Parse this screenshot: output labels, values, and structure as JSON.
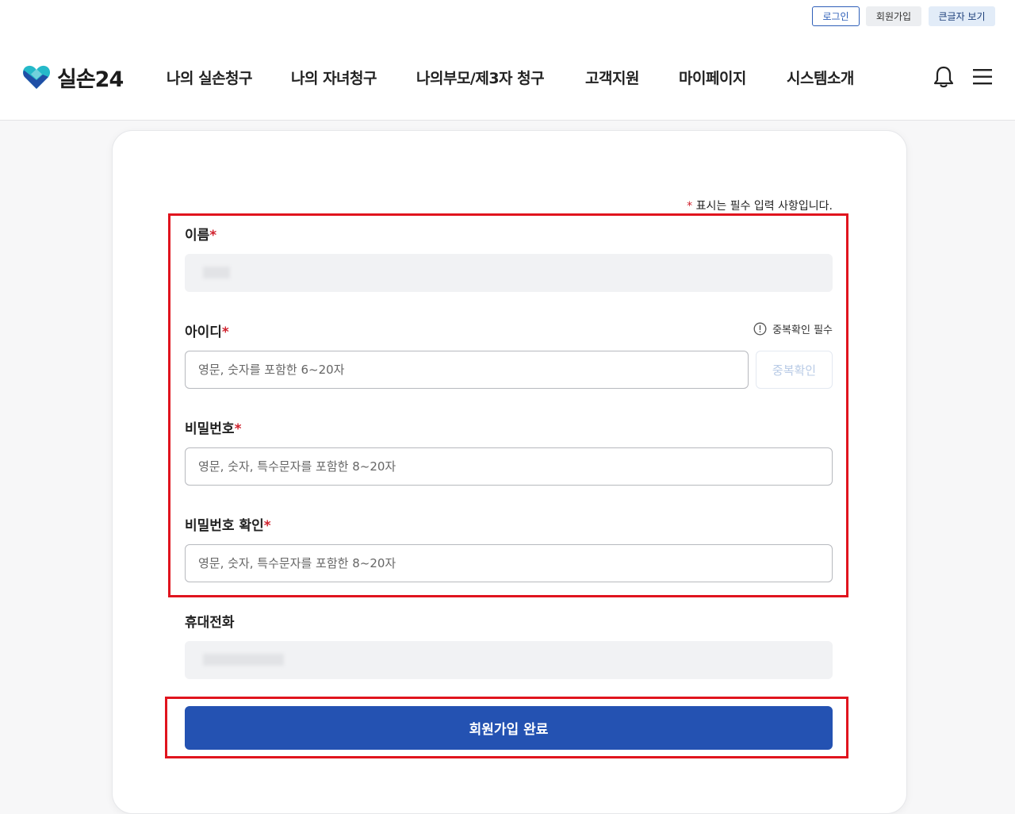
{
  "header": {
    "util": {
      "login": "로그인",
      "join": "회원가입",
      "large_text": "큰글자 보기"
    },
    "logo_text": "실손24",
    "nav": [
      "나의 실손청구",
      "나의 자녀청구",
      "나의부모/제3자 청구",
      "고객지원",
      "마이페이지",
      "시스템소개"
    ],
    "icons": [
      "bell-icon",
      "menu-icon"
    ]
  },
  "form": {
    "required_note": "표시는 필수 입력 사항입니다.",
    "required_mark": "*",
    "name": {
      "label": "이름"
    },
    "id": {
      "label": "아이디",
      "placeholder": "영문, 숫자를 포함한 6~20자",
      "dup_note": "중복확인 필수",
      "dup_button": "중복확인"
    },
    "password": {
      "label": "비밀번호",
      "placeholder": "영문, 숫자, 특수문자를 포함한 8~20자"
    },
    "password_confirm": {
      "label": "비밀번호 확인",
      "placeholder": "영문, 숫자, 특수문자를 포함한 8~20자"
    },
    "phone": {
      "label": "휴대전화"
    },
    "submit": "회원가입 완료"
  },
  "colors": {
    "primary": "#2452b2",
    "required": "#d0212d",
    "highlight": "#e0141e"
  }
}
